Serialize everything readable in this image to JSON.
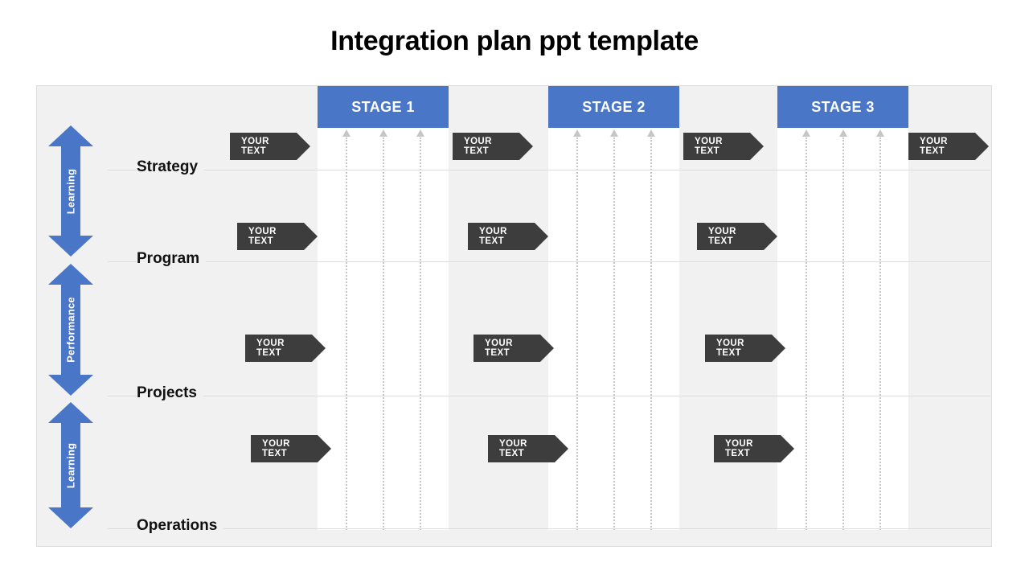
{
  "title": "Integration plan ppt template",
  "stages": [
    {
      "label": "STAGE 1"
    },
    {
      "label": "STAGE 2"
    },
    {
      "label": "STAGE 3"
    }
  ],
  "rows": [
    {
      "label": "Strategy"
    },
    {
      "label": "Program"
    },
    {
      "label": "Projects"
    },
    {
      "label": "Operations"
    }
  ],
  "side_arrows": [
    {
      "label": "Learning"
    },
    {
      "label": "Performance"
    },
    {
      "label": "Learning"
    }
  ],
  "tags": {
    "text": "YOUR TEXT",
    "row_strategy": [
      "YOUR TEXT",
      "YOUR TEXT",
      "YOUR TEXT",
      "YOUR TEXT"
    ],
    "row_program": [
      "YOUR TEXT",
      "YOUR TEXT",
      "YOUR TEXT"
    ],
    "row_projects": [
      "YOUR TEXT",
      "YOUR TEXT",
      "YOUR TEXT"
    ],
    "row_operations": [
      "YOUR TEXT",
      "YOUR TEXT",
      "YOUR TEXT"
    ]
  },
  "colors": {
    "accent_blue": "#4a76c8",
    "tag_dark": "#3d3d3d",
    "canvas_bg": "#f1f1f1",
    "column_bg": "#ffffff",
    "divider": "#dcdcdc",
    "dotted": "#c6c6c6"
  }
}
